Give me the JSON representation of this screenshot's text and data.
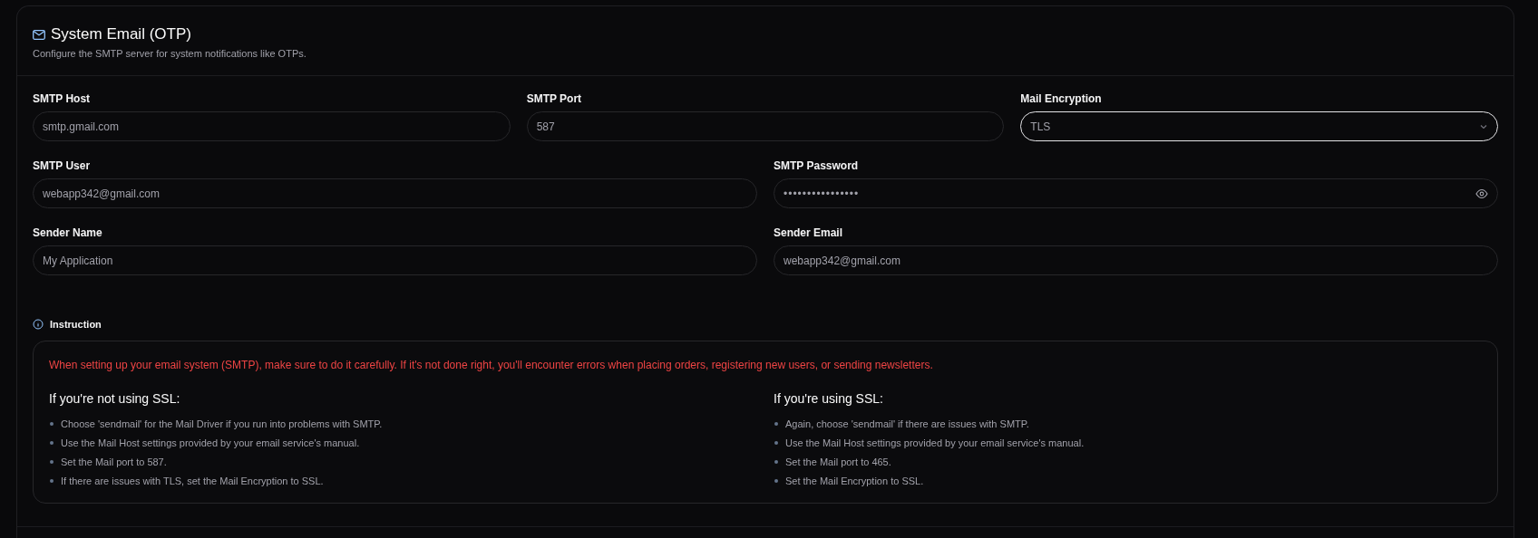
{
  "card": {
    "title": "System Email (OTP)",
    "subtitle": "Configure the SMTP server for system notifications like OTPs."
  },
  "form": {
    "rows": [
      {
        "fields": [
          {
            "label": "SMTP Host",
            "kind": "text",
            "value": "smtp.gmail.com",
            "focused": false
          },
          {
            "label": "SMTP Port",
            "kind": "text",
            "value": "587",
            "focused": false
          },
          {
            "label": "Mail Encryption",
            "kind": "select",
            "value": "TLS",
            "focused": true
          }
        ]
      },
      {
        "fields": [
          {
            "label": "SMTP User",
            "kind": "text",
            "value": "webapp342@gmail.com",
            "focused": false
          },
          {
            "label": "SMTP Password",
            "kind": "password",
            "value": "••••••••••••••••",
            "focused": false
          }
        ]
      },
      {
        "fields": [
          {
            "label": "Sender Name",
            "kind": "text",
            "value": "My Application",
            "focused": false
          },
          {
            "label": "Sender Email",
            "kind": "text",
            "value": "webapp342@gmail.com",
            "focused": false
          }
        ]
      }
    ]
  },
  "instruction": {
    "title": "Instruction",
    "warning": "When setting up your email system (SMTP), make sure to do it carefully. If it's not done right, you'll encounter errors when placing orders, registering new users, or sending newsletters.",
    "columns": [
      {
        "heading": "If you're not using SSL:",
        "items": [
          "Choose 'sendmail' for the Mail Driver if you run into problems with SMTP.",
          "Use the Mail Host settings provided by your email service's manual.",
          "Set the Mail port to 587.",
          "If there are issues with TLS, set the Mail Encryption to SSL."
        ]
      },
      {
        "heading": "If you're using SSL:",
        "items": [
          "Again, choose 'sendmail' if there are issues with SMTP.",
          "Use the Mail Host settings provided by your email service's manual.",
          "Set the Mail port to 465.",
          "Set the Mail Encryption to SSL."
        ]
      }
    ]
  }
}
